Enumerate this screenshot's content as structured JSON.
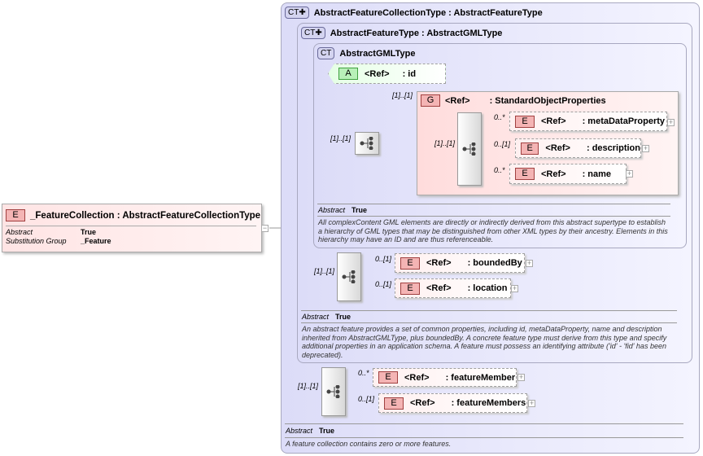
{
  "root_element": {
    "badge": "E",
    "name": "_FeatureCollection : AbstractFeatureCollectionType",
    "props": [
      {
        "k": "Abstract",
        "v": "True"
      },
      {
        "k": "Substitution Group",
        "v": "_Feature"
      }
    ],
    "collapse": "−"
  },
  "ct_collection": {
    "badge": "CT",
    "title": "AbstractFeatureCollectionType : AbstractFeatureType",
    "abstract_label": "Abstract",
    "abstract_value": "True",
    "description": "A feature collection contains zero or more features.",
    "sequence_card": "[1]..[1]",
    "children": [
      {
        "badge": "E",
        "ref": "<Ref>",
        "name": ": featureMember",
        "card": "0..*"
      },
      {
        "badge": "E",
        "ref": "<Ref>",
        "name": ": featureMembers",
        "card": "0..[1]"
      }
    ]
  },
  "ct_feature": {
    "badge": "CT",
    "title": "AbstractFeatureType : AbstractGMLType",
    "abstract_label": "Abstract",
    "abstract_value": "True",
    "description": "An abstract feature provides a set of common properties, including id, metaDataProperty, name and description inherited from AbstractGMLType, plus boundedBy.    A concrete feature type must derive from this type and specify additional  properties in an application schema. A feature must possess an identifying attribute ('id' - 'fid' has been deprecated).",
    "sequence_card": "[1]..[1]",
    "children": [
      {
        "badge": "E",
        "ref": "<Ref>",
        "name": ": boundedBy",
        "card": "0..[1]"
      },
      {
        "badge": "E",
        "ref": "<Ref>",
        "name": ": location",
        "card": "0..[1]"
      }
    ]
  },
  "ct_gml": {
    "badge": "CT",
    "title": "AbstractGMLType",
    "abstract_label": "Abstract",
    "abstract_value": "True",
    "description": "All complexContent GML elements are directly or indirectly derived from this abstract supertype to establish a hierarchy of GML types that may be distinguished from other XML types by their ancestry. Elements in this hierarchy may have an ID and are thus referenceable.",
    "sequence_card": "[1]..[1]",
    "attribute": {
      "badge": "A",
      "ref": "<Ref>",
      "name": ": id"
    },
    "group": {
      "badge": "G",
      "ref": "<Ref>",
      "name": ": StandardObjectProperties",
      "card": "[1]..[1]",
      "sequence_card": "[1]..[1]",
      "children": [
        {
          "badge": "E",
          "ref": "<Ref>",
          "name": ": metaDataProperty",
          "card": "0..*"
        },
        {
          "badge": "E",
          "ref": "<Ref>",
          "name": ": description",
          "card": "0..[1]"
        },
        {
          "badge": "E",
          "ref": "<Ref>",
          "name": ": name",
          "card": "0..*"
        }
      ]
    }
  },
  "expand_symbol": "+"
}
